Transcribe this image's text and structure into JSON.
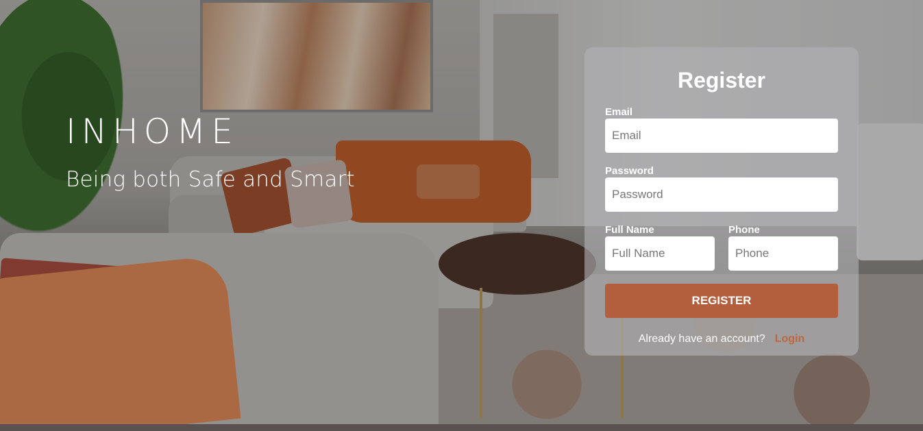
{
  "brand": {
    "logo": "INHOME",
    "tagline": "Being both Safe and Smart"
  },
  "register": {
    "title": "Register",
    "email": {
      "label": "Email",
      "placeholder": "Email"
    },
    "password": {
      "label": "Password",
      "placeholder": "Password"
    },
    "full_name": {
      "label": "Full Name",
      "placeholder": "Full Name"
    },
    "phone": {
      "label": "Phone",
      "placeholder": "Phone"
    },
    "submit_label": "REGISTER",
    "account_prompt": "Already have an account?",
    "login_label": "Login"
  },
  "colors": {
    "accent": "#b35e3c",
    "link": "#c0653e"
  }
}
